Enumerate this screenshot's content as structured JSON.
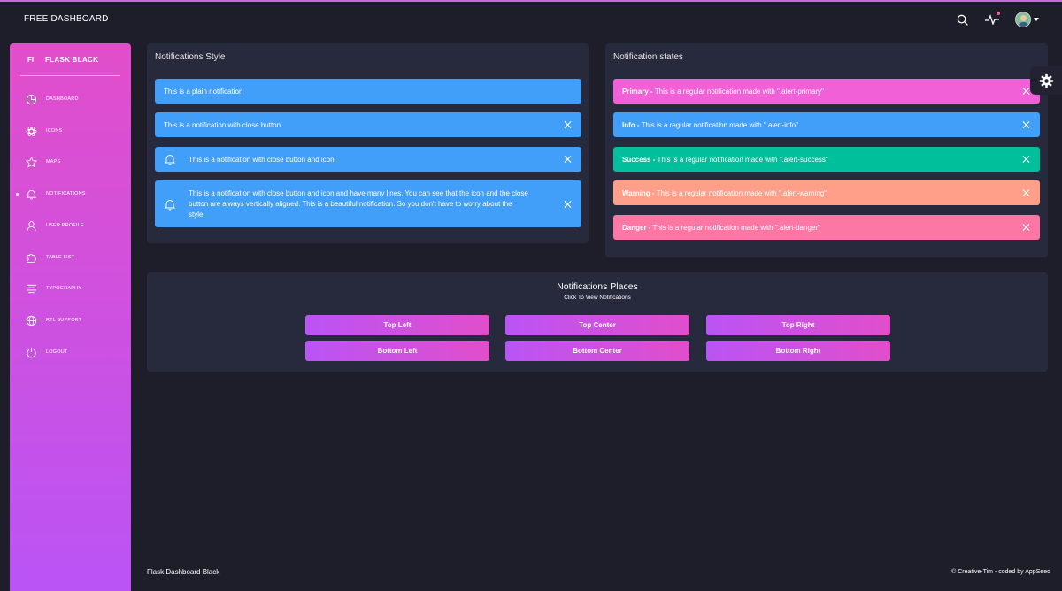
{
  "navbar": {
    "brand": "FREE DASHBOARD"
  },
  "sidebar": {
    "mini": "FI",
    "title": "FLASK BLACK",
    "items": [
      {
        "label": "DASHBOARD",
        "icon": "chart-pie-icon"
      },
      {
        "label": "ICONS",
        "icon": "atom-icon"
      },
      {
        "label": "MAPS",
        "icon": "pin-icon"
      },
      {
        "label": "NOTIFICATIONS",
        "icon": "bell-icon",
        "active": true
      },
      {
        "label": "USER PROFILE",
        "icon": "user-icon"
      },
      {
        "label": "TABLE LIST",
        "icon": "puzzle-icon"
      },
      {
        "label": "TYPOGRAPHY",
        "icon": "align-center-icon"
      },
      {
        "label": "RTL SUPPORT",
        "icon": "world-icon"
      },
      {
        "label": "LOGOUT",
        "icon": "power-icon"
      }
    ]
  },
  "styles_card": {
    "title": "Notifications Style",
    "alerts": [
      "This is a plain notification",
      "This is a notification with close button.",
      "This is a notification with close button and icon.",
      "This is a notification with close button and icon and have many lines. You can see that the icon and the close button are always vertically aligned. This is a beautiful notification. So you don't have to worry about the style."
    ]
  },
  "states_card": {
    "title": "Notification states",
    "alerts": [
      {
        "label": "Primary -",
        "text": " This is a regular notification made with \".alert-primary\""
      },
      {
        "label": "Info -",
        "text": " This is a regular notification made with \".alert-info\""
      },
      {
        "label": "Success -",
        "text": " This is a regular notification made with \".alert-success\""
      },
      {
        "label": "Warning -",
        "text": " This is a regular notification made with \".alert-warning\""
      },
      {
        "label": "Danger -",
        "text": " This is a regular notification made with \".alert-danger\""
      }
    ]
  },
  "places_card": {
    "title": "Notifications Places",
    "subtitle": "Click To View Notifications",
    "buttons": [
      "Top Left",
      "Top Center",
      "Top Right",
      "Bottom Left",
      "Bottom Center",
      "Bottom Right"
    ]
  },
  "footer": {
    "left": "Flask Dashboard Black",
    "right_prefix": "© Creative-Tim - coded by ",
    "right_brand": "AppSeed"
  },
  "colors": {
    "info": "#419ef9",
    "primary": "#f160d6",
    "success": "#00bf9a",
    "warning": "#ff9f89",
    "danger": "#fd77a4",
    "sidebar_gradient_top": "#e14eca",
    "sidebar_gradient_bottom": "#ba54f5"
  }
}
